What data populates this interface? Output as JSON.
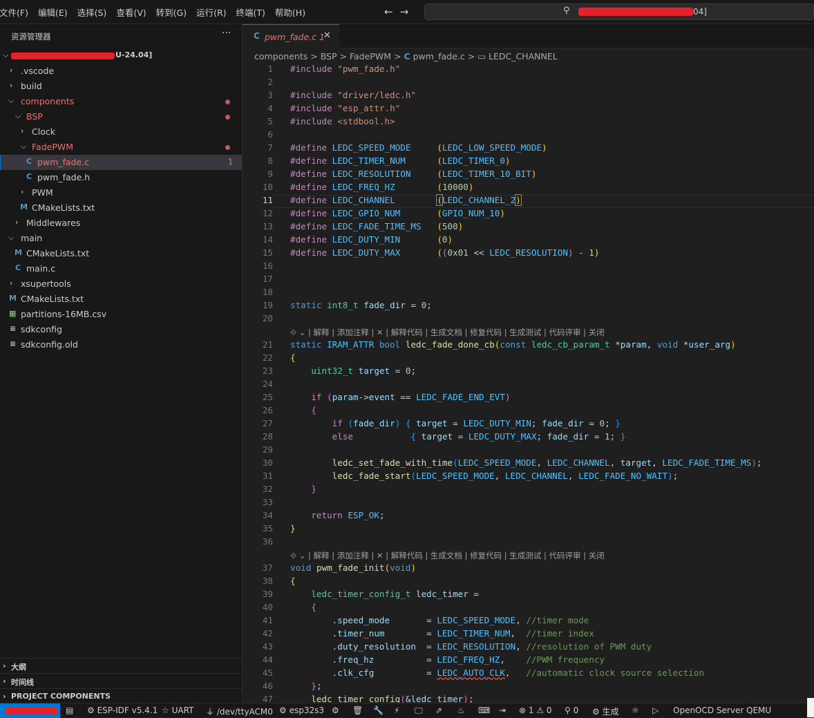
{
  "menu": [
    "文件(F)",
    "编辑(E)",
    "选择(S)",
    "查看(V)",
    "转到(G)",
    "运行(R)",
    "终端(T)",
    "帮助(H)"
  ],
  "nav": {
    "back": "←",
    "forward": "→"
  },
  "command_center": {
    "search_icon": "⚲",
    "title_visible": "04]"
  },
  "explorer": {
    "title": "资源管理器",
    "more": "···",
    "root_suffix": "U-24.04]",
    "items": [
      {
        "label": ".vscode"
      },
      {
        "label": "build"
      },
      {
        "label": "components"
      },
      {
        "label": "BSP"
      },
      {
        "label": "Clock"
      },
      {
        "label": "FadePWM"
      },
      {
        "label": "pwm_fade.c",
        "badge": "1"
      },
      {
        "label": "pwm_fade.h"
      },
      {
        "label": "PWM"
      },
      {
        "label": "CMakeLists.txt"
      },
      {
        "label": "Middlewares"
      },
      {
        "label": "main"
      },
      {
        "label": "CMakeLists.txt"
      },
      {
        "label": "main.c"
      },
      {
        "label": "xsupertools"
      },
      {
        "label": "CMakeLists.txt"
      },
      {
        "label": "partitions-16MB.csv"
      },
      {
        "label": "sdkconfig"
      },
      {
        "label": "sdkconfig.old"
      }
    ],
    "icons": {
      "c": "C",
      "m": "M",
      "csv": "▦",
      "gear": "≡"
    }
  },
  "panels": {
    "outline": "大纲",
    "timeline": "时间线",
    "project": "PROJECT COMPONENTS"
  },
  "tab": {
    "icon": "C",
    "name": "pwm_fade.c",
    "badge": "1",
    "close": "✕"
  },
  "breadcrumbs": {
    "parts": [
      "components",
      "BSP",
      "FadePWM",
      "pwm_fade.c",
      "LEDC_CHANNEL"
    ],
    "sep": ">",
    "c_icon": "C",
    "sym_icon": "▭"
  },
  "codelens": "⟐ ⌄ | 解释 | 添加注释 | ✕ | 解释代码 | 生成文档 | 修复代码 | 生成测试 | 代码评审 | 关闭",
  "current_line": 11,
  "status": {
    "espidf": "ESP-IDF v5.4.1",
    "uart": "UART",
    "port": "/dev/ttyACM0",
    "target": "esp32s3",
    "problems": "⊗ 1 ⚠ 0",
    "ports": "⚲ 0",
    "build": "生成",
    "openocd": "OpenOCD Server",
    "qemu": "QEMU"
  },
  "colors": {
    "accent": "#0078d4",
    "modified": "#e57373",
    "editor_bg": "#1f1f1f",
    "sidebar_bg": "#181818"
  }
}
